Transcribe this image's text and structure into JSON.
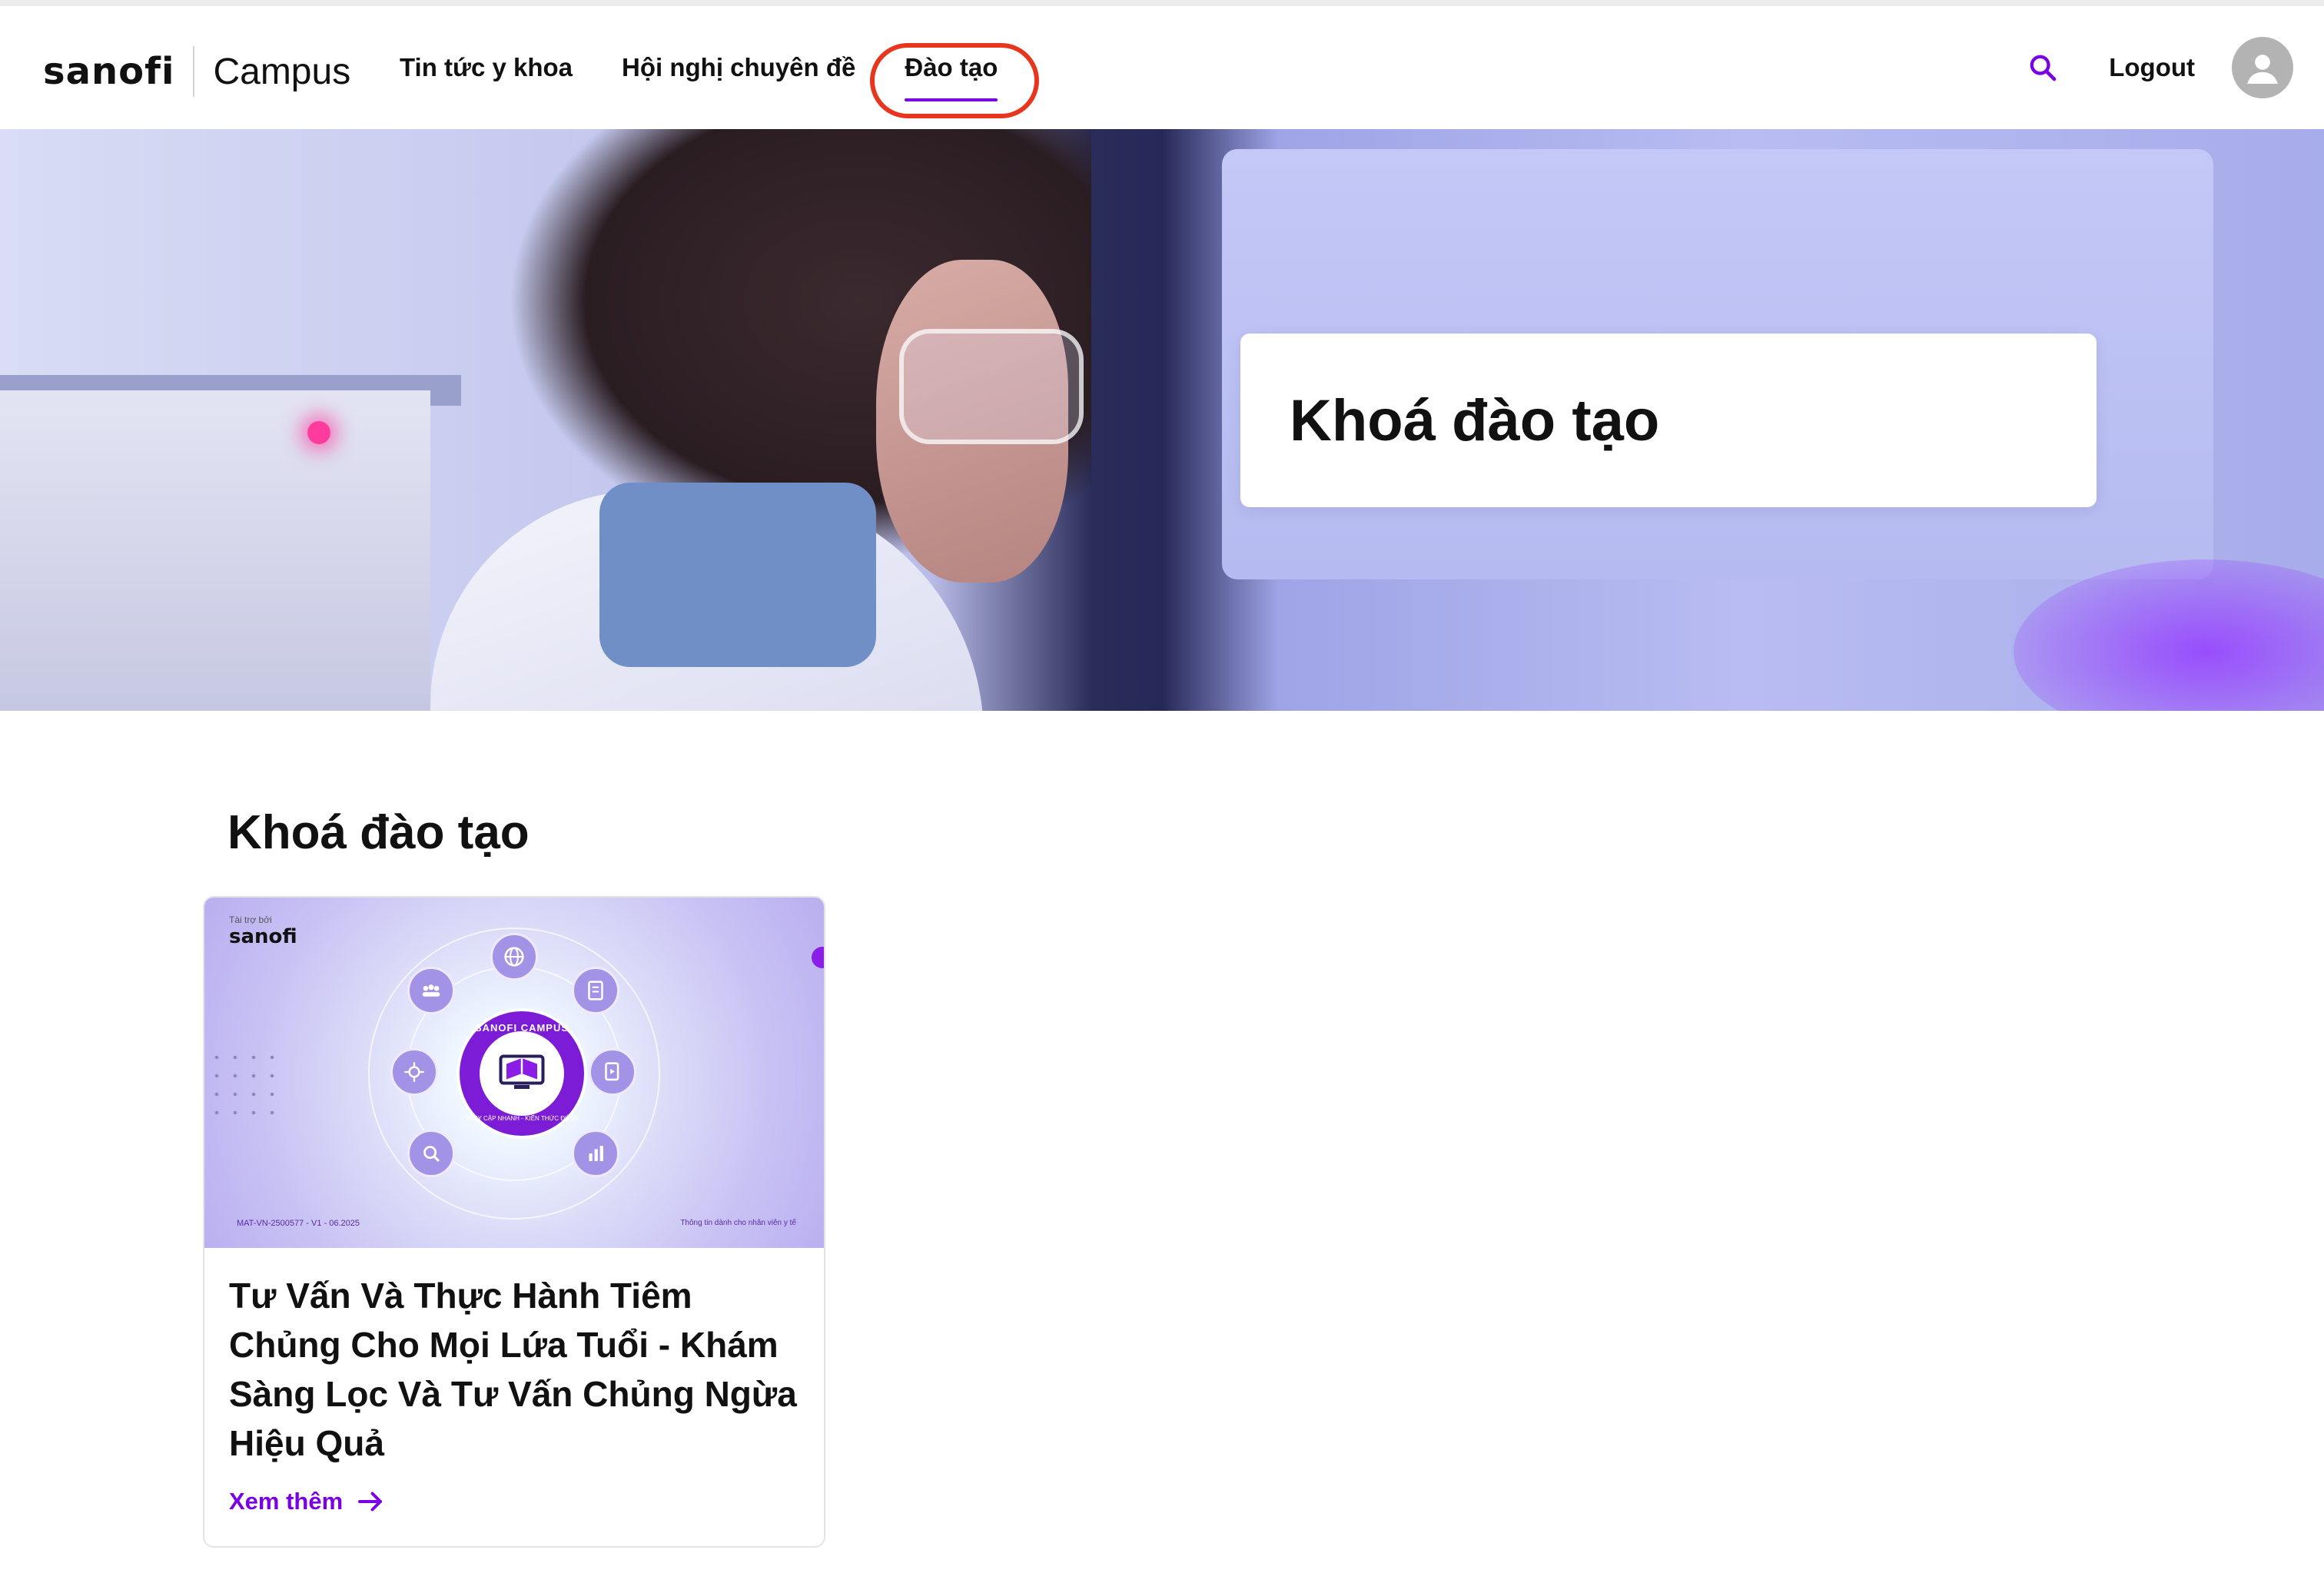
{
  "header": {
    "logo_wordmark": "sanofi",
    "logo_product": "Campus",
    "nav": [
      {
        "label": "Tin tức y khoa",
        "active": false
      },
      {
        "label": "Hội nghị chuyên đề",
        "active": false
      },
      {
        "label": "Đào tạo",
        "active": true
      }
    ],
    "logout_label": "Logout",
    "search_icon": "search-icon",
    "avatar_icon": "user-avatar-icon",
    "accent_color": "#7a00e6",
    "highlight_color": "#e8351d"
  },
  "hero": {
    "title": "Khoá đào tạo"
  },
  "section": {
    "title": "Khoá đào tạo"
  },
  "courses": [
    {
      "thumbnail": {
        "sponsor_small": "Tài trợ bởi",
        "brand": "sanofi",
        "badge_text": "SANOFI CAMPUS",
        "badge_subtext": "TRUY CẬP NHANH - KIẾN THỨC ĐÚNG",
        "code": "MAT-VN-2500577 - V1 - 06.2025",
        "footer_note": "Thông tin dành cho nhân viên y tế"
      },
      "title": "Tư Vấn Và Thực Hành Tiêm Chủng Cho Mọi Lứa Tuổi - Khám Sàng Lọc Và Tư Vấn Chủng Ngừa Hiệu Quả",
      "more_label": "Xem thêm",
      "more_icon": "arrow-right-icon"
    }
  ]
}
